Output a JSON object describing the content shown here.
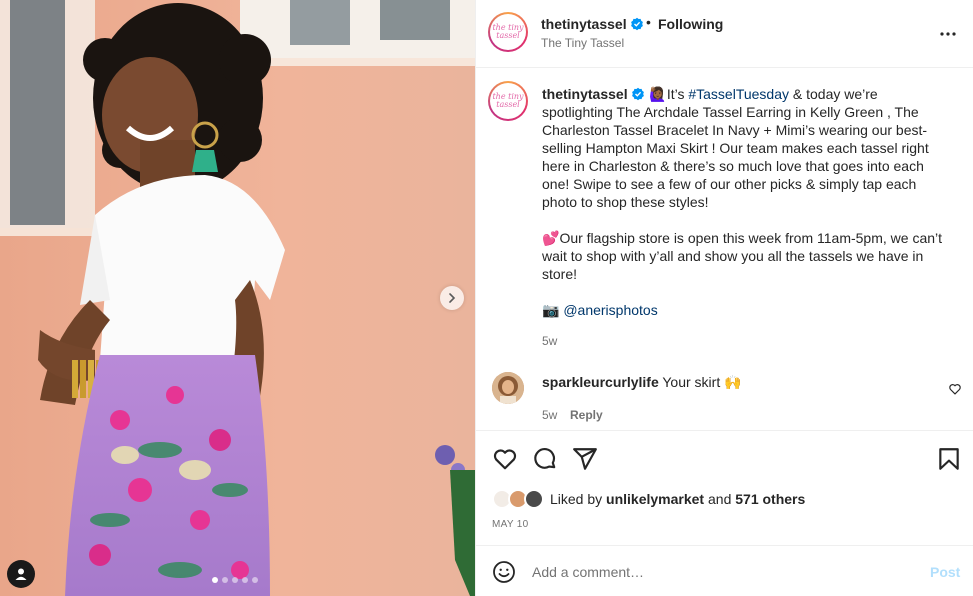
{
  "post": {
    "author_username": "thetinytassel",
    "author_display_name": "The Tiny Tassel",
    "avatar_text": "the tiny tassel",
    "follow_status": "Following",
    "separator": "•"
  },
  "caption": {
    "username": "thetinytassel",
    "emoji_intro": "🙋🏾‍♀️",
    "text_1": "It’s",
    "hashtag": "#TasselTuesday",
    "text_2": "& today we’re spotlighting The Archdale Tassel Earring in Kelly Green , The Charleston Tassel Bracelet In Navy + Mimi’s wearing our best-selling Hampton Maxi Skirt ! Our team makes each tassel right here in Charleston & there’s so much love that goes into each one! Swipe to see a few of our other picks & simply tap each photo to shop these styles!",
    "para_2_emoji": "💕",
    "para_2": "Our flagship store is open this week from 11am-5pm, we can’t wait to shop with y’all and show you all the tassels we have in store!",
    "para_3_emoji": "📷",
    "photographer_mention": "@anerisphotos",
    "age": "5w"
  },
  "comments": [
    {
      "username": "sparkleurcurlylife",
      "text": "Your skirt 🙌",
      "age": "5w",
      "reply_label": "Reply"
    }
  ],
  "likes": {
    "prefix": "Liked by",
    "first_liker": "unlikelymarket",
    "conjunction": "and",
    "others": "571 others"
  },
  "date": "May 10",
  "add_comment": {
    "placeholder": "Add a comment…",
    "post_label": "Post"
  },
  "carousel": {
    "slide_count": 6,
    "active_index": 0
  },
  "colors": {
    "link": "#00376b",
    "verified": "#0095f6",
    "post_disabled": "#b2dffc",
    "secondary_text": "#737373"
  },
  "icons": [
    "verified-badge-icon",
    "more-options-icon",
    "chevron-right-icon",
    "user-tag-icon",
    "heart-icon",
    "comment-icon",
    "share-icon",
    "bookmark-icon",
    "emoji-icon"
  ]
}
